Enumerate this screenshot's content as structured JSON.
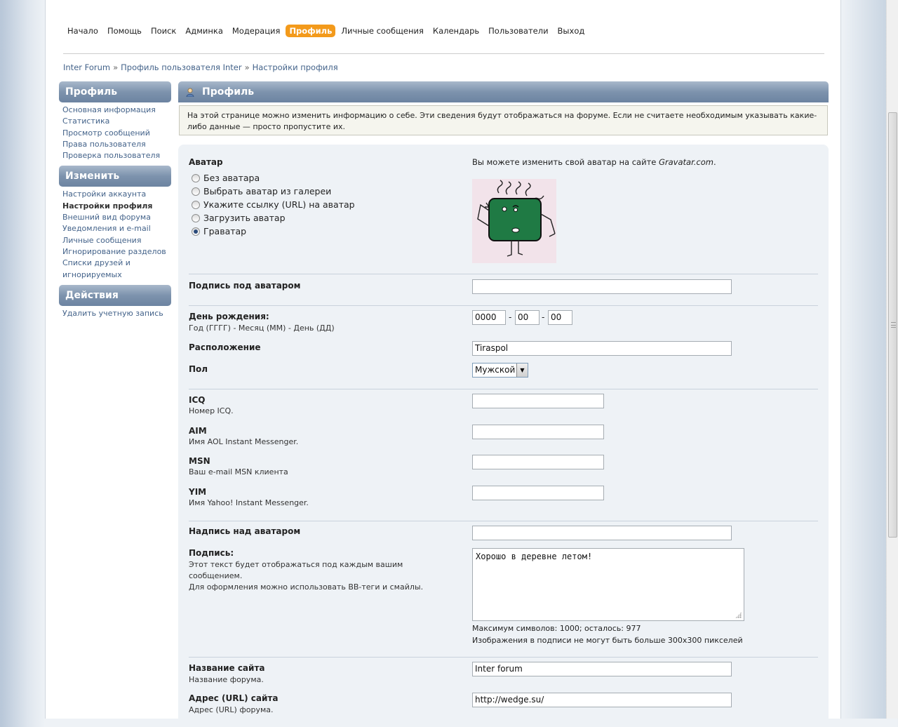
{
  "nav": {
    "items": [
      "Начало",
      "Помощь",
      "Поиск",
      "Админка",
      "Модерация",
      "Профиль",
      "Личные сообщения",
      "Календарь",
      "Пользователи",
      "Выход"
    ],
    "active": "Профиль"
  },
  "breadcrumb": [
    "Inter Forum",
    "Профиль пользователя Inter",
    "Настройки профиля"
  ],
  "breadcrumb_sep": "»",
  "sidebar": {
    "profile_title": "Профиль",
    "profile_items": [
      "Основная информация",
      "Статистика",
      "Просмотр сообщений",
      "Права пользователя",
      "Проверка пользователя"
    ],
    "edit_title": "Изменить",
    "edit_items": [
      "Настройки аккаунта",
      "Настройки профиля",
      "Внешний вид форума",
      "Уведомления и e-mail",
      "Личные сообщения",
      "Игнорирование разделов",
      "Списки друзей и игнорируемых"
    ],
    "edit_current": "Настройки профиля",
    "actions_title": "Действия",
    "actions_items": [
      "Удалить учетную запись"
    ]
  },
  "main": {
    "title": "Профиль",
    "intro": "На этой странице можно изменить информацию о себе. Эти сведения будут отображаться на форуме. Если не считаете необходимым указывать какие-либо данные — просто пропустите их."
  },
  "form": {
    "avatar": {
      "label": "Аватар",
      "gravatar_note_prefix": "Вы можете изменить свой аватар на сайте ",
      "gravatar_note_site": "Gravatar.com",
      "gravatar_note_suffix": ".",
      "options": [
        "Без аватара",
        "Выбрать аватар из галереи",
        "Укажите ссылку (URL) на аватар",
        "Загрузить аватар",
        "Граватар"
      ],
      "selected": "Граватар"
    },
    "avatar_caption": {
      "label": "Подпись под аватаром",
      "value": ""
    },
    "birthday": {
      "label": "День рождения:",
      "desc": "Год (ГГГГ) - Месяц (ММ) - День (ДД)",
      "year": "0000",
      "month": "00",
      "day": "00",
      "sep": "-"
    },
    "location": {
      "label": "Расположение",
      "value": "Tiraspol"
    },
    "gender": {
      "label": "Пол",
      "value": "Мужской"
    },
    "icq": {
      "label": "ICQ",
      "desc": "Номер ICQ.",
      "value": ""
    },
    "aim": {
      "label": "AIM",
      "desc": "Имя AOL Instant Messenger.",
      "value": ""
    },
    "msn": {
      "label": "MSN",
      "desc": "Ваш e-mail MSN клиента",
      "value": ""
    },
    "yim": {
      "label": "YIM",
      "desc": "Имя Yahoo! Instant Messenger.",
      "value": ""
    },
    "title_above_avatar": {
      "label": "Надпись над аватаром",
      "value": ""
    },
    "signature": {
      "label": "Подпись:",
      "desc1": "Этот текст будет отображаться под каждым вашим сообщением.",
      "desc2": "Для оформления можно использовать BB-теги и смайлы.",
      "value": "Хорошо в деревне летом!",
      "max_note": "Максимум символов: 1000; осталось: 977",
      "img_note": "Изображения в подписи не могут быть больше 300x300 пикселей"
    },
    "site_name": {
      "label": "Название сайта",
      "desc": "Название форума.",
      "value": "Inter forum"
    },
    "site_url": {
      "label": "Адрес (URL) сайта",
      "desc": "Адрес (URL) форума.",
      "value": "http://wedge.su/"
    }
  },
  "colors": {
    "accent": "#f39a1b",
    "header": "#7d93ad",
    "link": "#44638a",
    "avatar_bg": "#f2dfe8",
    "avatar_body": "#1f7a44"
  }
}
